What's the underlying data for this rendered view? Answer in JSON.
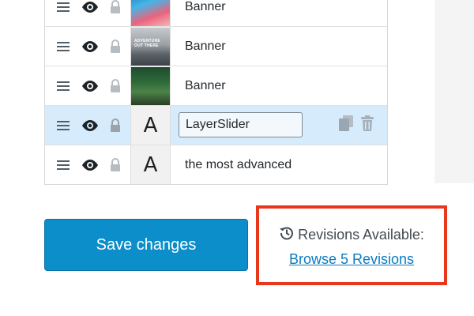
{
  "layers": [
    {
      "thumbnail_type": "image",
      "thumbnail_name": "banner-thumbnail-1",
      "thumb_text": "",
      "label": "Banner",
      "editing": false,
      "active": false
    },
    {
      "thumbnail_type": "image",
      "thumbnail_name": "banner-thumbnail-2",
      "thumb_text": "ADVENTURE\nOUT THERE",
      "label": "Banner",
      "editing": false,
      "active": false
    },
    {
      "thumbnail_type": "image",
      "thumbnail_name": "banner-thumbnail-3",
      "thumb_text": "",
      "label": "Banner",
      "editing": false,
      "active": false
    },
    {
      "thumbnail_type": "text",
      "thumbnail_name": "text-layer-icon",
      "thumb_text": "A",
      "label": "",
      "input_value": "LayerSlider",
      "editing": true,
      "active": true
    },
    {
      "thumbnail_type": "text",
      "thumbnail_name": "text-layer-icon",
      "thumb_text": "A",
      "label": "the most advanced",
      "editing": false,
      "active": false
    }
  ],
  "actions": {
    "save_label": "Save changes"
  },
  "revisions": {
    "title": "Revisions Available:",
    "link_label": "Browse 5 Revisions"
  },
  "icons": {
    "drag": "drag-handle-icon",
    "visibility": "eye-icon",
    "lock": "lock-icon",
    "duplicate": "duplicate-icon",
    "delete": "trash-icon",
    "history": "history-icon"
  },
  "colors": {
    "active_row": "#d6ebfb",
    "primary_button": "#0b8ec9",
    "link": "#0a7cc0",
    "highlight_border": "#e8381c"
  }
}
